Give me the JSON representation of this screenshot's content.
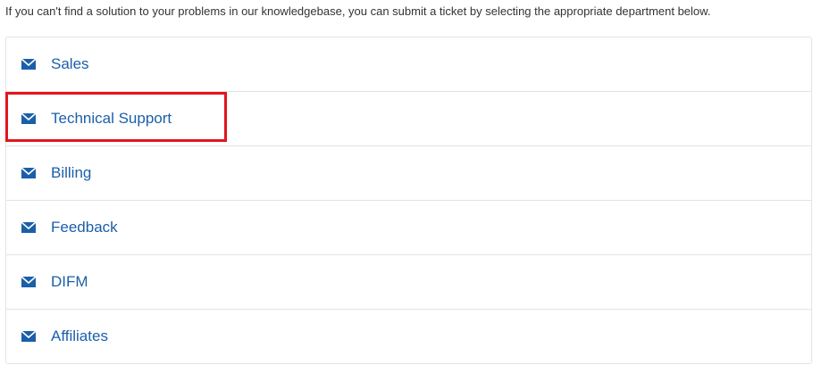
{
  "intro_text": "If you can't find a solution to your problems in our knowledgebase, you can submit a ticket by selecting the appropriate department below.",
  "departments": [
    {
      "label": "Sales",
      "icon": "envelope-icon"
    },
    {
      "label": "Technical Support",
      "icon": "envelope-icon",
      "highlighted": true
    },
    {
      "label": "Billing",
      "icon": "envelope-icon"
    },
    {
      "label": "Feedback",
      "icon": "envelope-icon"
    },
    {
      "label": "DIFM",
      "icon": "envelope-icon"
    },
    {
      "label": "Affiliates",
      "icon": "envelope-icon"
    }
  ],
  "colors": {
    "link": "#1b5fa8",
    "icon": "#1b5fa8",
    "highlight": "#e0161e",
    "border": "#e3e3e3"
  }
}
